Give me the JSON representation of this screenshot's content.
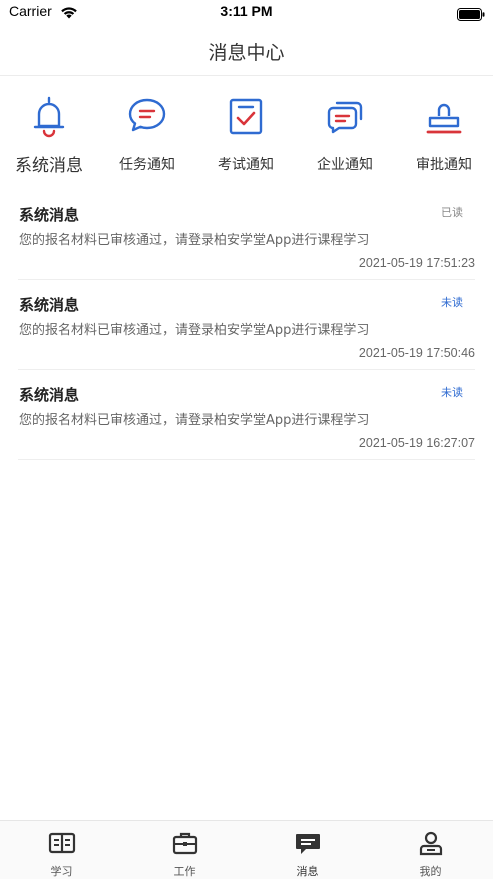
{
  "status_bar": {
    "carrier": "Carrier",
    "time": "3:11 PM"
  },
  "nav": {
    "title": "消息中心"
  },
  "categories": [
    {
      "label": "系统消息",
      "icon": "bell-icon",
      "active": true
    },
    {
      "label": "任务通知",
      "icon": "chat-bubble-icon",
      "active": false
    },
    {
      "label": "考试通知",
      "icon": "checklist-icon",
      "active": false
    },
    {
      "label": "企业通知",
      "icon": "messages-icon",
      "active": false
    },
    {
      "label": "审批通知",
      "icon": "stamp-icon",
      "active": false
    }
  ],
  "messages": [
    {
      "title": "系统消息",
      "status": "已读",
      "unread": false,
      "body": "您的报名材料已审核通过，请登录柏安学堂App进行课程学习",
      "time": "2021-05-19 17:51:23"
    },
    {
      "title": "系统消息",
      "status": "未读",
      "unread": true,
      "body": "您的报名材料已审核通过，请登录柏安学堂App进行课程学习",
      "time": "2021-05-19 17:50:46"
    },
    {
      "title": "系统消息",
      "status": "未读",
      "unread": true,
      "body": "您的报名材料已审核通过，请登录柏安学堂App进行课程学习",
      "time": "2021-05-19 16:27:07"
    }
  ],
  "tabs": [
    {
      "label": "学习",
      "icon": "book-icon"
    },
    {
      "label": "工作",
      "icon": "briefcase-icon"
    },
    {
      "label": "消息",
      "icon": "message-icon",
      "active": true
    },
    {
      "label": "我的",
      "icon": "user-icon"
    }
  ],
  "colors": {
    "accent_blue": "#2f6bd1",
    "accent_red": "#d9343a",
    "unread_blue": "#2f6bd1"
  }
}
